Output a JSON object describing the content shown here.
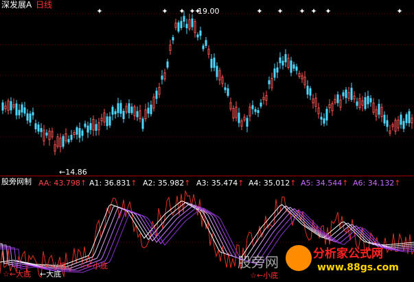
{
  "price_pane": {
    "stock_name": "深发展A",
    "period": "日线",
    "high_label": "19.00",
    "low_label": "14.86",
    "colors": {
      "up": "#ff5555",
      "down": "#4fd8ff",
      "grid": "#7a0000",
      "stock_name": "#ffffff",
      "period": "#ff3030",
      "star": "#ffffff"
    }
  },
  "indicator_pane": {
    "name": "股旁网制",
    "readouts": [
      {
        "key": "AA:",
        "value": "43.798",
        "color": "#ff4444"
      },
      {
        "key": "A1:",
        "value": "36.831",
        "color": "#ffffff"
      },
      {
        "key": "A2:",
        "value": "35.982",
        "color": "#ffffff"
      },
      {
        "key": "A3:",
        "value": "35.474",
        "color": "#ffffff"
      },
      {
        "key": "A4:",
        "value": "35.012",
        "color": "#ffffff"
      },
      {
        "key": "A5:",
        "value": "34.544",
        "color": "#cc66ff"
      },
      {
        "key": "A6:",
        "value": "34.132",
        "color": "#cc66ff"
      }
    ],
    "markers": {
      "big_bottom": "大底",
      "small_bottom": "小底",
      "star": "☆",
      "arrow": "←"
    }
  },
  "watermark": {
    "left_text": "股旁网",
    "brand": "分析家公式网",
    "url": "www.88gs.com"
  }
}
